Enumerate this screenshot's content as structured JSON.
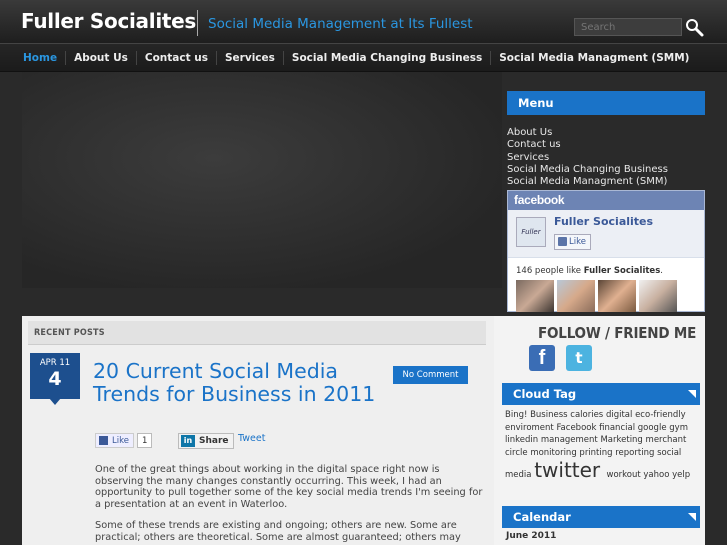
{
  "header": {
    "site_title": "Fuller Socialites",
    "tagline": "Social Media Management at Its Fullest",
    "search_placeholder": "Search"
  },
  "nav": {
    "items": [
      "Home",
      "About Us",
      "Contact us",
      "Services",
      "Social Media Changing Business",
      "Social Media Managment (SMM)"
    ],
    "active": "Home"
  },
  "menu": {
    "title": "Menu",
    "items": [
      "About Us",
      "Contact us",
      "Services",
      "Social Media Changing Business",
      "Social Media Managment (SMM)"
    ]
  },
  "facebook": {
    "brand": "facebook",
    "page_name": "Fuller Socialites",
    "logo_text": "Fuller",
    "like_label": "Like",
    "count_prefix": "146 people like ",
    "count_page": "Fuller Socialites",
    "count_suffix": "."
  },
  "content": {
    "section_title": "Recent Posts",
    "post": {
      "month": "APR 11",
      "day": "4",
      "title": "20 Current Social Media Trends for Business in 2011",
      "comment_label": "No Comment",
      "like_label": "Like",
      "like_count": "1",
      "share_label": "Share",
      "tweet_label": "Tweet",
      "paragraph1": "One of the great things about working in the digital space right now is observing the many changes constantly occurring. This week, I had an opportunity to pull together some of the key social media trends I'm seeing for a presentation at an event in Waterloo.",
      "paragraph2": "Some of these trends are existing and ongoing; others are new. Some are practical; others are theoretical. Some are almost guaranteed; others may"
    }
  },
  "sidebar": {
    "follow_title": "Follow / Friend Me",
    "cloud_title": "Cloud Tag",
    "tags": [
      "Bing!",
      "Business",
      "calories",
      "digital",
      "eco-friendly",
      "enviroment",
      "Facebook",
      "financial",
      "google",
      "gym",
      "linkedin",
      "management",
      "Marketing",
      "merchant",
      "circle",
      "monitoring",
      "printing",
      "reporting",
      "social",
      "media",
      "twitter",
      "workout",
      "yahoo",
      "yelp"
    ],
    "calendar_title": "Calendar",
    "calendar_month": "June 2011"
  },
  "colors": {
    "accent": "#1a73c8",
    "tagline": "#2a96e0",
    "date_badge": "#1d4f8e",
    "facebook_blue": "#3b5998"
  }
}
